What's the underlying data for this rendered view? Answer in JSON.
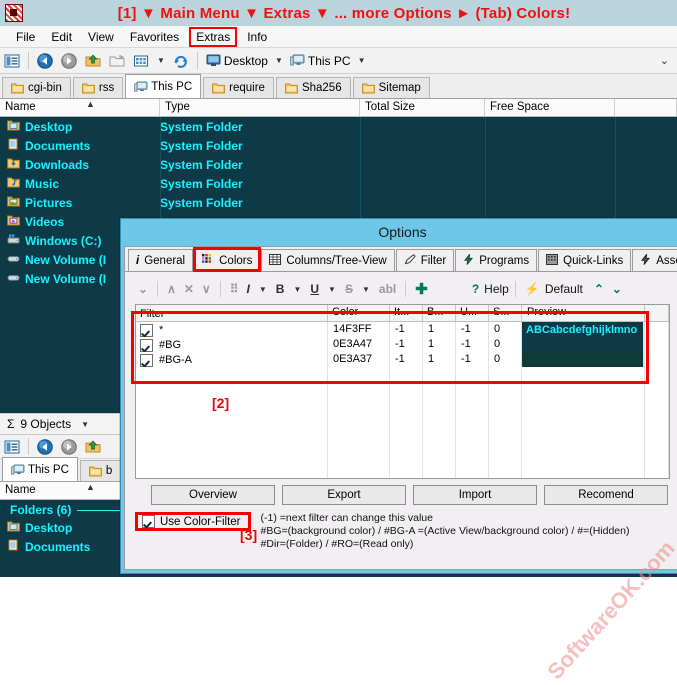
{
  "window": {
    "banner": "[1] ▼ Main Menu ▼ Extras ▼ ... more Options ► (Tab) Colors!",
    "app_icon": "app-icon"
  },
  "menubar": {
    "items": [
      {
        "label": "File",
        "highlighted": false
      },
      {
        "label": "Edit",
        "highlighted": false
      },
      {
        "label": "View",
        "highlighted": false
      },
      {
        "label": "Favorites",
        "highlighted": false
      },
      {
        "label": "Extras",
        "highlighted": true
      },
      {
        "label": "Info",
        "highlighted": false
      }
    ]
  },
  "toolbar": {
    "icons": [
      "list-view-icon",
      "back-icon",
      "forward-icon",
      "up-folder-icon",
      "new-folder-icon",
      "view-grid-icon",
      "refresh-icon"
    ],
    "breadcrumbs": [
      {
        "label": "Desktop",
        "icon": "desktop-icon"
      },
      {
        "label": "This PC",
        "icon": "computer-icon"
      }
    ],
    "expand_glyph": "⌄"
  },
  "tabs": [
    {
      "label": "cgi-bin",
      "icon": "folder-icon",
      "active": false
    },
    {
      "label": "rss",
      "icon": "folder-icon",
      "active": false
    },
    {
      "label": "This PC",
      "icon": "computer-icon",
      "active": true
    },
    {
      "label": "require",
      "icon": "folder-icon",
      "active": false
    },
    {
      "label": "Sha256",
      "icon": "folder-icon",
      "active": false
    },
    {
      "label": "Sitemap",
      "icon": "folder-icon",
      "active": false
    }
  ],
  "list": {
    "columns": [
      "Name",
      "Type",
      "Total Size",
      "Free Space"
    ],
    "sort_indicator": "▲",
    "rows": [
      {
        "name": "Desktop",
        "type": "System Folder",
        "total_size": "",
        "free_space": "",
        "icon": "desktop-folder-icon"
      },
      {
        "name": "Documents",
        "type": "System Folder",
        "total_size": "",
        "free_space": "",
        "icon": "documents-folder-icon"
      },
      {
        "name": "Downloads",
        "type": "System Folder",
        "total_size": "",
        "free_space": "",
        "icon": "downloads-folder-icon"
      },
      {
        "name": "Music",
        "type": "System Folder",
        "total_size": "",
        "free_space": "",
        "icon": "music-folder-icon"
      },
      {
        "name": "Pictures",
        "type": "System Folder",
        "total_size": "",
        "free_space": "",
        "icon": "pictures-folder-icon"
      },
      {
        "name": "Videos",
        "type": "",
        "total_size": "",
        "free_space": "",
        "icon": "videos-folder-icon"
      },
      {
        "name": "Windows (C:)",
        "type": "",
        "total_size": "",
        "free_space": "",
        "icon": "hard-drive-icon"
      },
      {
        "name": "New Volume (I",
        "type": "",
        "total_size": "",
        "free_space": "",
        "icon": "drive-icon"
      },
      {
        "name": "New Volume (I",
        "type": "",
        "total_size": "",
        "free_space": "",
        "icon": "drive-icon"
      }
    ]
  },
  "statusbar": {
    "sigma": "Σ",
    "text": "9 Objects",
    "caret": "▼"
  },
  "pane2": {
    "tabs": [
      {
        "label": "This PC",
        "icon": "computer-icon",
        "active": true
      },
      {
        "label": "b",
        "icon": "folder-icon",
        "active": false
      }
    ],
    "column": "Name",
    "sort_indicator": "▲",
    "group_label": "Folders (6)",
    "rows": [
      {
        "name": "Desktop",
        "icon": "desktop-folder-icon"
      },
      {
        "name": "Documents",
        "icon": "documents-folder-icon"
      }
    ]
  },
  "dialog": {
    "title": "Options",
    "tabs": [
      {
        "label": "General",
        "icon": "info-icon",
        "selected": false
      },
      {
        "label": "Colors",
        "icon": "color-dots-icon",
        "selected": true
      },
      {
        "label": "Columns/Tree-View",
        "icon": "table-icon",
        "selected": false
      },
      {
        "label": "Filter",
        "icon": "filter-pen-icon",
        "selected": false
      },
      {
        "label": "Programs",
        "icon": "lightning-icon",
        "selected": false
      },
      {
        "label": "Quick-Links",
        "icon": "grid-icon",
        "selected": false
      },
      {
        "label": "Associa",
        "icon": "lightning-icon",
        "selected": false
      }
    ],
    "toolbar": {
      "items": [
        {
          "name": "apply-check-icon",
          "glyph": "⌄"
        },
        {
          "name": "move-up-icon",
          "glyph": "∧"
        },
        {
          "name": "delete-x-icon",
          "glyph": "✕"
        },
        {
          "name": "move-down-icon",
          "glyph": "∨"
        },
        {
          "name": "palette-icon",
          "glyph": "⠿"
        },
        {
          "name": "italic-icon",
          "glyph": "I"
        },
        {
          "name": "bold-icon",
          "glyph": "B"
        },
        {
          "name": "underline-icon",
          "glyph": "U"
        },
        {
          "name": "strikethrough-icon",
          "glyph": "S"
        },
        {
          "name": "abc-icon",
          "glyph": "abl"
        },
        {
          "name": "add-plus-icon",
          "glyph": "✚"
        }
      ],
      "help_label": "Help",
      "help_glyph": "?",
      "default_label": "Default",
      "default_glyph": "⚡",
      "collapse_up_glyph": "⌃",
      "collapse_down_glyph": "⌄"
    },
    "grid": {
      "columns": [
        "Filter",
        "Color",
        "It...",
        "B...",
        "U...",
        "S...",
        "Preview",
        ""
      ],
      "rows": [
        {
          "checked": true,
          "filter": "*",
          "color": "14F3FF",
          "it": "-1",
          "b": "1",
          "u": "-1",
          "s": "0",
          "preview_text": "ABCabcdefghijklmno",
          "preview_bg": "#0E3A47",
          "preview_fg": "#14F3FF"
        },
        {
          "checked": true,
          "filter": "#BG",
          "color": "0E3A47",
          "it": "-1",
          "b": "1",
          "u": "-1",
          "s": "0",
          "preview_text": "",
          "preview_bg": "#0E3A47",
          "preview_fg": "#0E3A47"
        },
        {
          "checked": true,
          "filter": "#BG-A",
          "color": "0E3A37",
          "it": "-1",
          "b": "1",
          "u": "-1",
          "s": "0",
          "preview_text": "",
          "preview_bg": "#0E3A37",
          "preview_fg": "#0E3A37"
        }
      ]
    },
    "buttons": [
      {
        "label": "Overview"
      },
      {
        "label": "Export"
      },
      {
        "label": "Import"
      },
      {
        "label": "Recomend"
      }
    ],
    "use_color_filter": {
      "label": "Use Color-Filter",
      "checked": true
    },
    "legend_lines": [
      "(-1) =next filter can change this value",
      "#BG=(background color) / #BG-A =(Active View/background color) / #=(Hidden)",
      "#Dir=(Folder) / #RO=(Read only)"
    ]
  },
  "markers": {
    "m2": "[2]",
    "m3": "[3]"
  },
  "watermark": "SoftwareOK.com",
  "colors": {
    "list_bg": "#0E3A47",
    "list_fg": "#14F3FF",
    "marker_red": "#f40000",
    "dialog_title_bg": "#6EC6E8",
    "titlebar_bg": "#b9d4dc"
  }
}
